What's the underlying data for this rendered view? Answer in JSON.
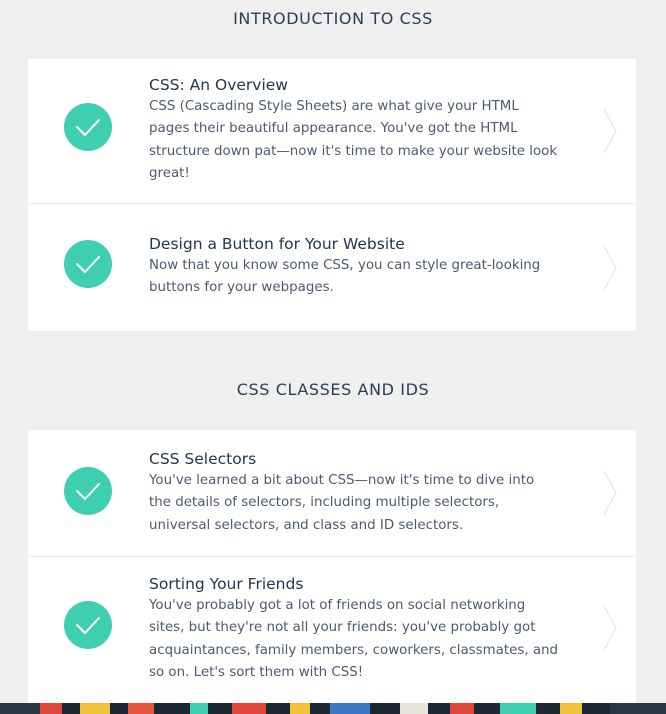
{
  "sections": [
    {
      "title": "INTRODUCTION TO CSS",
      "lessons": [
        {
          "title": "CSS: An Overview",
          "description": "CSS (Cascading Style Sheets) are what give your HTML pages their beautiful appearance. You've got the HTML structure down pat—now it's time to make your website look great!",
          "status": "completed"
        },
        {
          "title": "Design a Button for Your Website",
          "description": "Now that you know some CSS, you can style great-looking buttons for your webpages.",
          "status": "completed"
        }
      ]
    },
    {
      "title": "CSS CLASSES AND IDS",
      "lessons": [
        {
          "title": "CSS Selectors",
          "description": "You've learned a bit about CSS—now it's time to dive into the details of selectors, including multiple selectors, universal selectors, and class and ID selectors.",
          "status": "completed"
        },
        {
          "title": "Sorting Your Friends",
          "description": "You've probably got a lot of friends on social networking sites, but they're not all your friends: you've probably got acquaintances, family members, coworkers, classmates, and so on. Let's sort them with CSS!",
          "status": "completed"
        }
      ]
    }
  ],
  "colors": {
    "background": "#eeefee",
    "card": "#ffffff",
    "check_accent": "#3ecfb0",
    "title_text": "#253551",
    "body_text": "#4c5a70",
    "chevron": "#e4e6e8"
  },
  "icons": {
    "completed": "check-icon",
    "row_arrow": "chevron-right-icon"
  }
}
